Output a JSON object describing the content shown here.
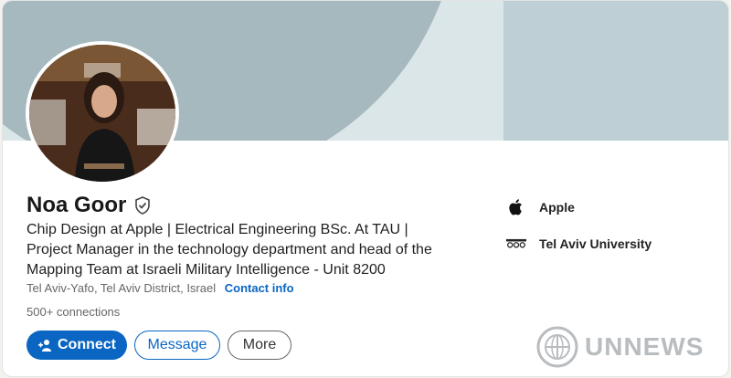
{
  "profile": {
    "name": "Noa Goor",
    "headline": "Chip Design at Apple | Electrical Engineering BSc. At TAU | Project Manager in the technology department and head of the Mapping Team at Israeli Military Intelligence - Unit 8200",
    "location": "Tel Aviv-Yafo, Tel Aviv District, Israel",
    "contact_link": "Contact info",
    "connections": "500+ connections",
    "avatar": "profile-photo"
  },
  "actions": {
    "connect_label": "Connect",
    "message_label": "Message",
    "more_label": "More"
  },
  "experience": [
    {
      "label": "Apple",
      "icon": "apple-logo-icon"
    },
    {
      "label": "Tel Aviv University",
      "icon": "tau-logo-icon"
    }
  ],
  "watermark": {
    "text": "UNNEWS",
    "icon": "un-emblem-icon"
  },
  "colors": {
    "accent": "#0a66c2",
    "banner_dark": "#a6b9bf",
    "banner_light": "#dbe6e9"
  }
}
